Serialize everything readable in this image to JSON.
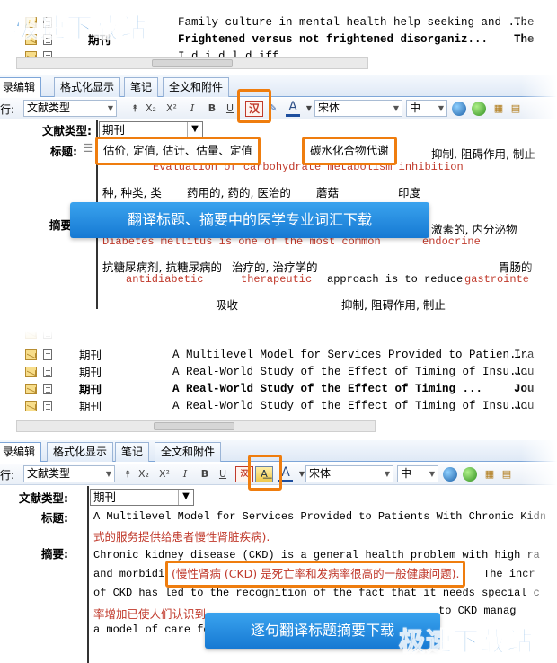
{
  "watermark": "极速下载站",
  "panel1": {
    "rows": [
      {
        "type": "",
        "title": "Family culture in mental health help-seeking and ...",
        "journal": "The",
        "bold": false
      },
      {
        "type": "期刊",
        "title": "Frightened versus not frightened disorganiz...",
        "journal": "The",
        "bold": true
      },
      {
        "type": "",
        "title": "I   d  i   d  l   d  iff",
        "journal": "",
        "bold": false
      }
    ],
    "tabs": [
      "录编辑",
      "格式化显示",
      "笔记",
      "全文和附件"
    ],
    "toolbar": {
      "field_prefix": "行:",
      "field_value": "文献类型",
      "font": "宋体",
      "size": "中",
      "translate_icon": "汉"
    },
    "form": {
      "type_label": "文献类型:",
      "type_value": "期刊",
      "title_label": "标题:",
      "abstract_label": "摘要",
      "gloss_a": "估价, 定值, 估计、估量、定值",
      "gloss_b": "碳水化合物代谢",
      "gloss_c": "抑制, 阻碍作用, 制止",
      "en_line1": "Evaluation      of carbohydrate metabolism    inhibition",
      "gloss_line2": [
        "种, 种类, 类",
        "药用的, 药的, 医治的",
        "蘑菇",
        "印度"
      ],
      "gloss_line3_tail": "激素的, 内分泌物",
      "en_line4a": "Diabetes mellitus is one of the most common",
      "en_line4b": "endocrine",
      "gloss_line5": [
        "抗糖尿病剂, 抗糖尿病的",
        "治疗的, 治疗学的",
        "胃肠的"
      ],
      "en_line6a": "antidiabetic",
      "en_line6b": "therapeutic",
      "en_line6c": "approach is to reduce",
      "en_line6d": "gastrointe",
      "gloss_line7": [
        "吸收",
        "抑制, 阻碍作用, 制止"
      ]
    },
    "banner": "翻译标题、摘要中的医学专业词汇下载"
  },
  "panel2": {
    "rows": [
      {
        "type": "期刊",
        "title": "A Multilevel Model for Services Provided to Patien...",
        "journal": "Ira",
        "bold": false
      },
      {
        "type": "期刊",
        "title": "A Real-World Study of the Effect of Timing of Insu...",
        "journal": "Jou",
        "bold": false
      },
      {
        "type": "期刊",
        "title": "A Real-World Study of the Effect of Timing ...",
        "journal": "Jou",
        "bold": true
      },
      {
        "type": "期刊",
        "title": "A Real-World Study of the Effect of Timing of Insu...",
        "journal": "Jou",
        "bold": false
      }
    ],
    "tabs": [
      "录编辑",
      "格式化显示",
      "笔记",
      "全文和附件"
    ],
    "toolbar": {
      "field_prefix": "行:",
      "field_value": "文献类型",
      "font": "宋体",
      "size": "中"
    },
    "form": {
      "type_label": "文献类型:",
      "type_value": "期刊",
      "title_label": "标题:",
      "abstract_label": "摘要:",
      "title_en": "A Multilevel Model for Services Provided to Patients With Chronic Kidn",
      "title_cn": "式的服务提供给患者慢性肾脏疾病).",
      "abs_line1": "Chronic kidney disease (CKD) is a general health problem with high ra",
      "abs_line2a": "and morbidit",
      "abs_line2_cn": "(慢性肾病 (CKD) 是死亡率和发病率很高的一般健康问题).",
      "abs_line2b": "The incr",
      "abs_line3": "of CKD has led to the recognition of the fact that it needs special c",
      "abs_line4_cn": "率增加已使人们认识到",
      "abs_line4b": "to CKD manag",
      "abs_line5": "a model of care fo"
    },
    "banner": "逐句翻译标题摘要下载"
  }
}
